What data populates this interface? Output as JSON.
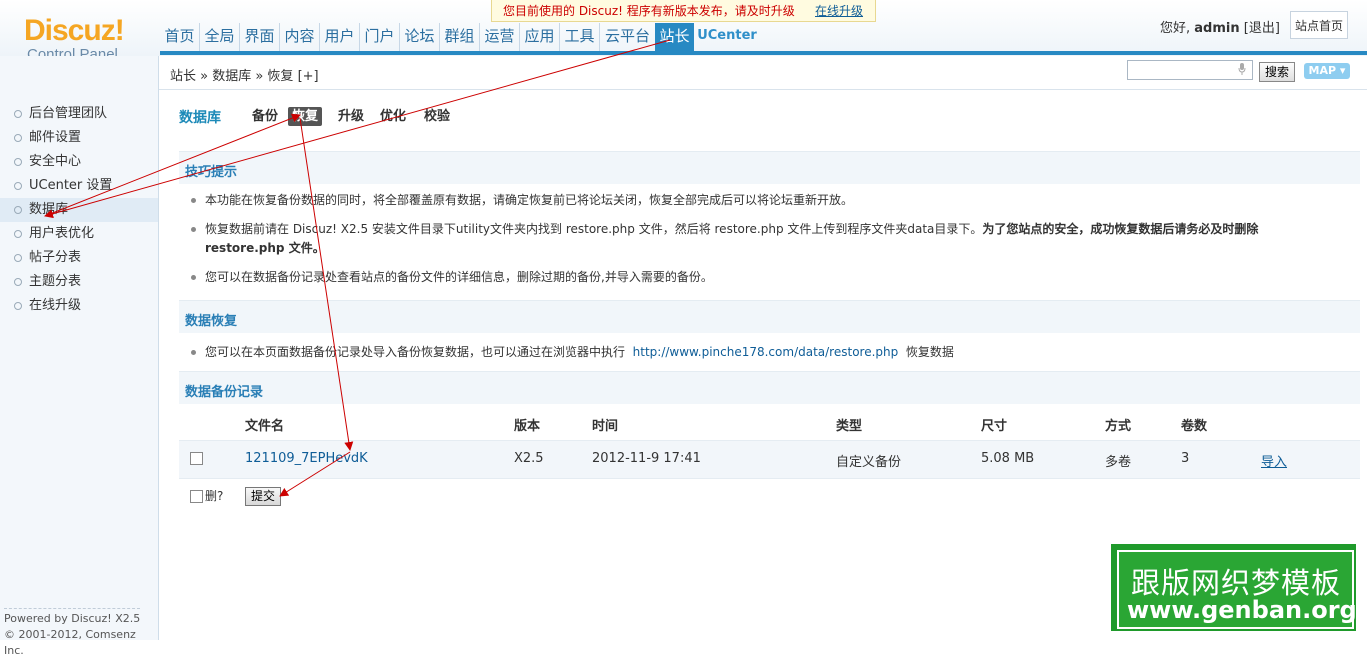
{
  "header": {
    "logo_brand": "Discuz!",
    "logo_sub": "Control Panel",
    "notice_text": "您目前使用的 Discuz! 程序有新版本发布，请及时升级",
    "notice_link": "在线升级",
    "nav": [
      "首页",
      "全局",
      "界面",
      "内容",
      "用户",
      "门户",
      "论坛",
      "群组",
      "运营",
      "应用",
      "工具",
      "云平台",
      "站长",
      "UCenter"
    ],
    "active_nav": "站长",
    "greeting": "您好,",
    "username": "admin",
    "logout": "[退出]",
    "home_button": "站点首页"
  },
  "breadcrumb": "站长 » 数据库 » 恢复 [+]",
  "search": {
    "button": "搜索",
    "map": "MAP"
  },
  "sidebar": {
    "items": [
      "后台管理团队",
      "邮件设置",
      "安全中心",
      "UCenter 设置",
      "数据库",
      "用户表优化",
      "帖子分表",
      "主题分表",
      "在线升级"
    ],
    "active": "数据库",
    "footer_line1": "Powered by Discuz! X2.5",
    "footer_line2": "© 2001-2012, Comsenz Inc."
  },
  "main": {
    "title": "数据库",
    "tabs": [
      "备份",
      "恢复",
      "升级",
      "优化",
      "校验"
    ],
    "active_tab": "恢复",
    "tips_title": "技巧提示",
    "tips": [
      "本功能在恢复备份数据的同时，将全部覆盖原有数据，请确定恢复前已将论坛关闭，恢复全部完成后可以将论坛重新开放。",
      "恢复数据前请在 Discuz! X2.5 安装文件目录下utility文件夹内找到 restore.php 文件，然后将 restore.php 文件上传到程序文件夹data目录下。",
      "为了您站点的安全，成功恢复数据后请务必及时删除 restore.php 文件。",
      "您可以在数据备份记录处查看站点的备份文件的详细信息，删除过期的备份,并导入需要的备份。"
    ],
    "restore_title": "数据恢复",
    "restore_text_pre": "您可以在本页面数据备份记录处导入备份恢复数据，也可以通过在浏览器中执行",
    "restore_link": "http://www.pinche178.com/data/restore.php",
    "restore_text_post": "恢复数据",
    "records_title": "数据备份记录",
    "table": {
      "headers": [
        "文件名",
        "版本",
        "时间",
        "类型",
        "尺寸",
        "方式",
        "卷数"
      ],
      "rows": [
        {
          "filename": "121109_7EPHevdK",
          "version": "X2.5",
          "time": "2012-11-9 17:41",
          "type": "自定义备份",
          "size": "5.08 MB",
          "mode": "多卷",
          "volumes": "3",
          "action": "导入"
        }
      ]
    },
    "delete_label": "删?",
    "submit_label": "提交"
  },
  "watermark": {
    "line1": "跟版网织梦模板",
    "line2": "www.genban.org"
  },
  "colors": {
    "accent": "#2789c3",
    "arrow": "#cc0000",
    "watermark": "#2aa634"
  }
}
